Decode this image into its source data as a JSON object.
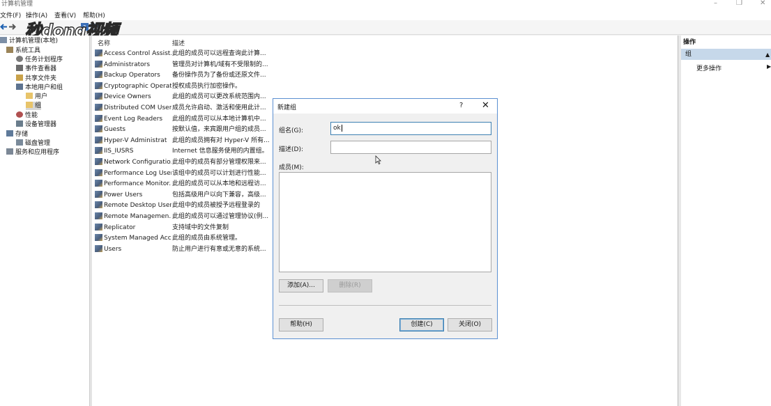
{
  "window": {
    "title": "计算机管理"
  },
  "menu": [
    "文件(F)",
    "操作(A)",
    "查看(V)",
    "帮助(H)"
  ],
  "watermark": "秒dong视频",
  "tree": {
    "root": "计算机管理(本地)",
    "items": [
      {
        "label": "系统工具"
      },
      {
        "label": "任务计划程序"
      },
      {
        "label": "事件查看器"
      },
      {
        "label": "共享文件夹"
      },
      {
        "label": "本地用户和组"
      },
      {
        "label": "用户"
      },
      {
        "label": "组"
      },
      {
        "label": "性能"
      },
      {
        "label": "设备管理器"
      },
      {
        "label": "存储"
      },
      {
        "label": "磁盘管理"
      },
      {
        "label": "服务和应用程序"
      }
    ]
  },
  "list": {
    "columns": [
      "名称",
      "描述"
    ],
    "rows": [
      {
        "name": "Access Control Assist...",
        "desc": "此组的成员可以远程查询此计算..."
      },
      {
        "name": "Administrators",
        "desc": "管理员对计算机/域有不受限制的..."
      },
      {
        "name": "Backup Operators",
        "desc": "备份操作员为了备份或还原文件..."
      },
      {
        "name": "Cryptographic Operat",
        "desc": "授权成员执行加密操作。"
      },
      {
        "name": "Device Owners",
        "desc": "此组的成员可以更改系统范围内..."
      },
      {
        "name": "Distributed COM Users",
        "desc": "成员允许启动、激活和使用此计..."
      },
      {
        "name": "Event Log Readers",
        "desc": "此组的成员可以从本地计算机中..."
      },
      {
        "name": "Guests",
        "desc": "按默认值，来宾跟用户组的成员..."
      },
      {
        "name": "Hyper-V Administrat",
        "desc": "此组的成员拥有对 Hyper-V 所有..."
      },
      {
        "name": "IIS_IUSRS",
        "desc": "Internet 信息服务使用的内置组。"
      },
      {
        "name": "Network Configuratio...",
        "desc": "此组中的成员有部分管理权限来..."
      },
      {
        "name": "Performance Log Users",
        "desc": "该组中的成员可以计划进行性能..."
      },
      {
        "name": "Performance Monitor...",
        "desc": "此组的成员可以从本地和远程访..."
      },
      {
        "name": "Power Users",
        "desc": "包括高级用户以向下兼容，高级..."
      },
      {
        "name": "Remote Desktop Users",
        "desc": "此组中的成员被授予远程登录的"
      },
      {
        "name": "Remote Managemen...",
        "desc": "此组的成员可以通过管理协议(例..."
      },
      {
        "name": "Replicator",
        "desc": "支持域中的文件复制"
      },
      {
        "name": "System Managed Acc...",
        "desc": "此组的成员由系统管理。"
      },
      {
        "name": "Users",
        "desc": "防止用户进行有意或无意的系统..."
      }
    ]
  },
  "actions": {
    "header": "操作",
    "section": "组",
    "more": "更多操作"
  },
  "dialog": {
    "title": "新建组",
    "help_glyph": "?",
    "close_glyph": "✕",
    "group_name_label": "组名(G):",
    "group_name_value": "ok",
    "description_label": "描述(D):",
    "description_value": "",
    "members_label": "成员(M):",
    "add_button": "添加(A)...",
    "remove_button": "删除(R)",
    "help_button": "帮助(H)",
    "create_button": "创建(C)",
    "close_button": "关闭(O)"
  },
  "colors": {
    "accent": "#3c7fb1",
    "selected_section": "#c6d8ea"
  }
}
